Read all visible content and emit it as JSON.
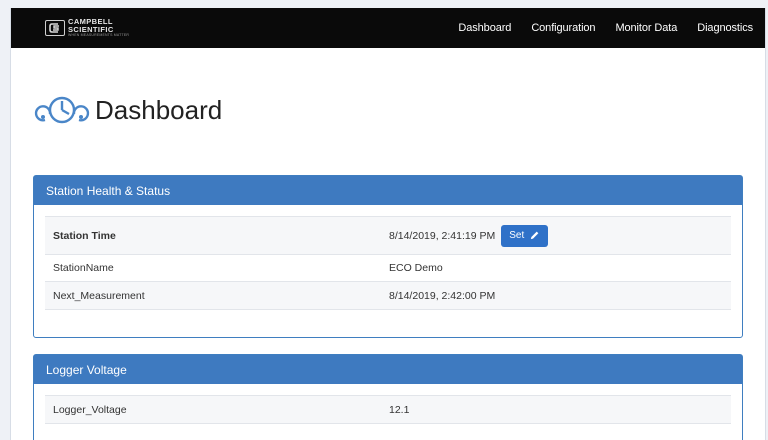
{
  "brand": {
    "line1": "CAMPBELL",
    "line2": "SCIENTIFIC",
    "tagline": "WHEN MEASUREMENTS MATTER"
  },
  "nav": [
    {
      "label": "Dashboard"
    },
    {
      "label": "Configuration"
    },
    {
      "label": "Monitor Data"
    },
    {
      "label": "Diagnostics"
    }
  ],
  "page": {
    "title": "Dashboard"
  },
  "station_panel": {
    "heading": "Station Health & Status",
    "station_time": {
      "key": "Station Time",
      "value": "8/14/2019, 2:41:19 PM",
      "button": "Set"
    },
    "rows": [
      {
        "key": "StationName",
        "value": "ECO Demo"
      },
      {
        "key": "Next_Measurement",
        "value": "8/14/2019, 2:42:00 PM"
      }
    ]
  },
  "voltage_panel": {
    "heading": "Logger Voltage",
    "rows": [
      {
        "key": "Logger_Voltage",
        "value": "12.1"
      }
    ]
  },
  "colors": {
    "navbar": "#0a0a0a",
    "panel_heading": "#3e7ac0",
    "button": "#2f71c8"
  },
  "icons": [
    "campbell-logo-icon",
    "dashboard-gauge-icon",
    "pencil-icon"
  ]
}
